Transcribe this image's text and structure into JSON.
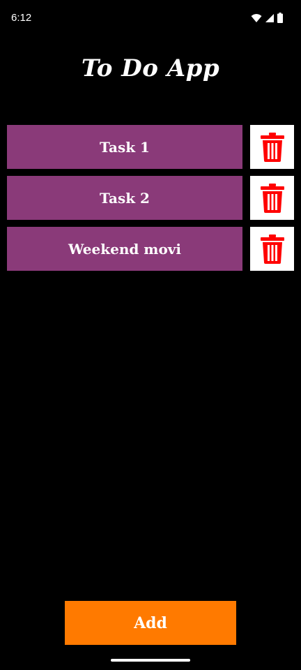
{
  "status_bar": {
    "time": "6:12",
    "icons": [
      "wifi-icon",
      "cell-signal-icon",
      "battery-icon"
    ]
  },
  "app": {
    "title": "To Do App"
  },
  "tasks": [
    {
      "label": "Task 1",
      "delete_icon": "trash-icon"
    },
    {
      "label": "Task 2",
      "delete_icon": "trash-icon"
    },
    {
      "label": "Weekend movi",
      "delete_icon": "trash-icon"
    }
  ],
  "add_button": {
    "label": "Add"
  },
  "colors": {
    "background": "#000000",
    "task_bg": "#8a3a79",
    "delete_bg": "#ffffff",
    "delete_icon": "#ff0000",
    "add_bg": "#ff7a00",
    "text": "#ffffff"
  }
}
